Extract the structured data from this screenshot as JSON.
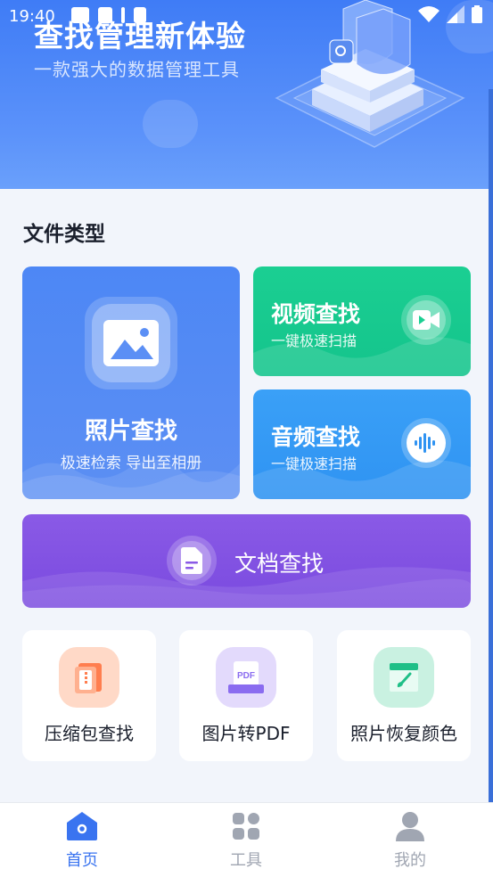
{
  "status_bar": {
    "time": "19:40"
  },
  "header": {
    "title": "查找管理新体验",
    "subtitle": "一款强大的数据管理工具"
  },
  "section": {
    "title": "文件类型"
  },
  "cards": {
    "photo": {
      "title": "照片查找",
      "subtitle": "极速检索 导出至相册",
      "icon": "image-icon"
    },
    "video": {
      "title": "视频查找",
      "subtitle": "一键极速扫描",
      "icon": "video-camera-icon"
    },
    "audio": {
      "title": "音频查找",
      "subtitle": "一键极速扫描",
      "icon": "audio-wave-icon"
    },
    "doc": {
      "title": "文档查找",
      "icon": "document-icon"
    }
  },
  "tools": [
    {
      "label": "压缩包查找",
      "icon": "zip-file-icon",
      "color": "#ff7e4f"
    },
    {
      "label": "图片转PDF",
      "icon": "pdf-icon",
      "color": "#8a6cf0"
    },
    {
      "label": "照片恢复颜色",
      "icon": "paint-brush-icon",
      "color": "#1fbf87"
    }
  ],
  "nav": [
    {
      "label": "首页",
      "icon": "home-icon",
      "active": true
    },
    {
      "label": "工具",
      "icon": "grid-icon",
      "active": false
    },
    {
      "label": "我的",
      "icon": "user-icon",
      "active": false
    }
  ],
  "colors": {
    "accent": "#3f7cf6",
    "nav_active": "#3a74f0",
    "nav_inactive": "#a0a6b2"
  }
}
